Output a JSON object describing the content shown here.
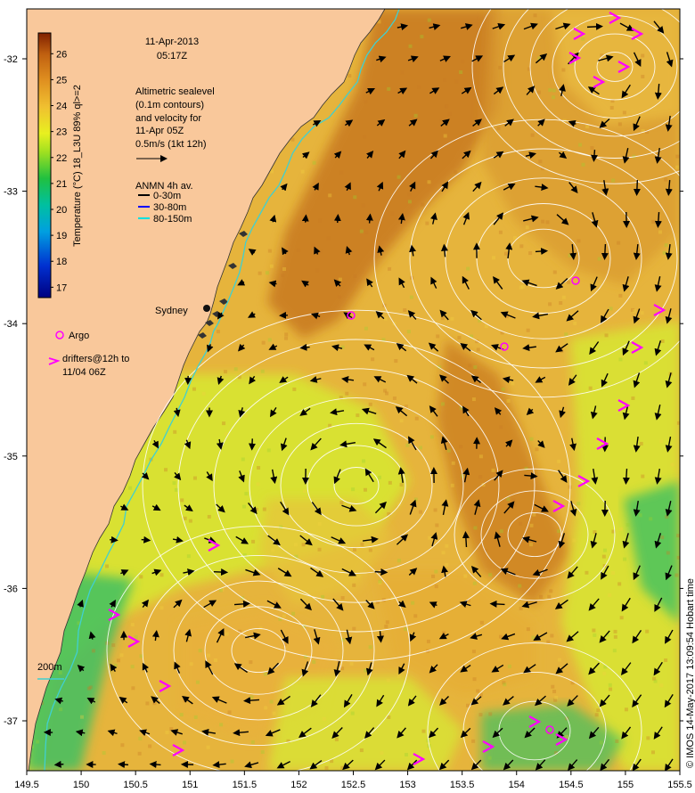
{
  "date": "11-Apr-2013",
  "time": "05:17Z",
  "altimetry_lines": [
    "Altimetric sealevel",
    "(0.1m contours)",
    "and velocity for",
    "11-Apr 05Z",
    "0.5m/s (1kt 12h)"
  ],
  "anmn": {
    "title": "ANMN 4h av.",
    "items": [
      {
        "label": "0-30m",
        "color": "#000000"
      },
      {
        "label": "30-80m",
        "color": "#0000ff"
      },
      {
        "label": "80-150m",
        "color": "#00e0e0"
      }
    ]
  },
  "city_label": "Sydney",
  "argo_label": "Argo",
  "drifters_lines": [
    "drifters@12h to",
    "11/04 06Z"
  ],
  "isobath_label": "200m",
  "credit": "© IMOS 14-May-2017 13:09:54 Hobart time",
  "colorbar": {
    "title": "Temperature (°C) 18_L3U 89% ql>=2",
    "ticks": [
      17,
      18,
      19,
      20,
      21,
      22,
      23,
      24,
      25,
      26
    ],
    "range": [
      16.6,
      26.8
    ]
  },
  "x_ticks": [
    "149.5",
    "150",
    "150.5",
    "151",
    "151.5",
    "152",
    "152.5",
    "153",
    "153.5",
    "154",
    "154.5",
    "155",
    "155.5"
  ],
  "y_ticks": [
    "-32",
    "-33",
    "-34",
    "-35",
    "-36",
    "-37"
  ],
  "colors": {
    "land": "#f9c89b",
    "warm": "#c8781e",
    "mid": "#e6b43c",
    "cool": "#d8e632",
    "cold": "#40c060",
    "argo": "#ff00ff",
    "isobath": "#40d0d0"
  }
}
